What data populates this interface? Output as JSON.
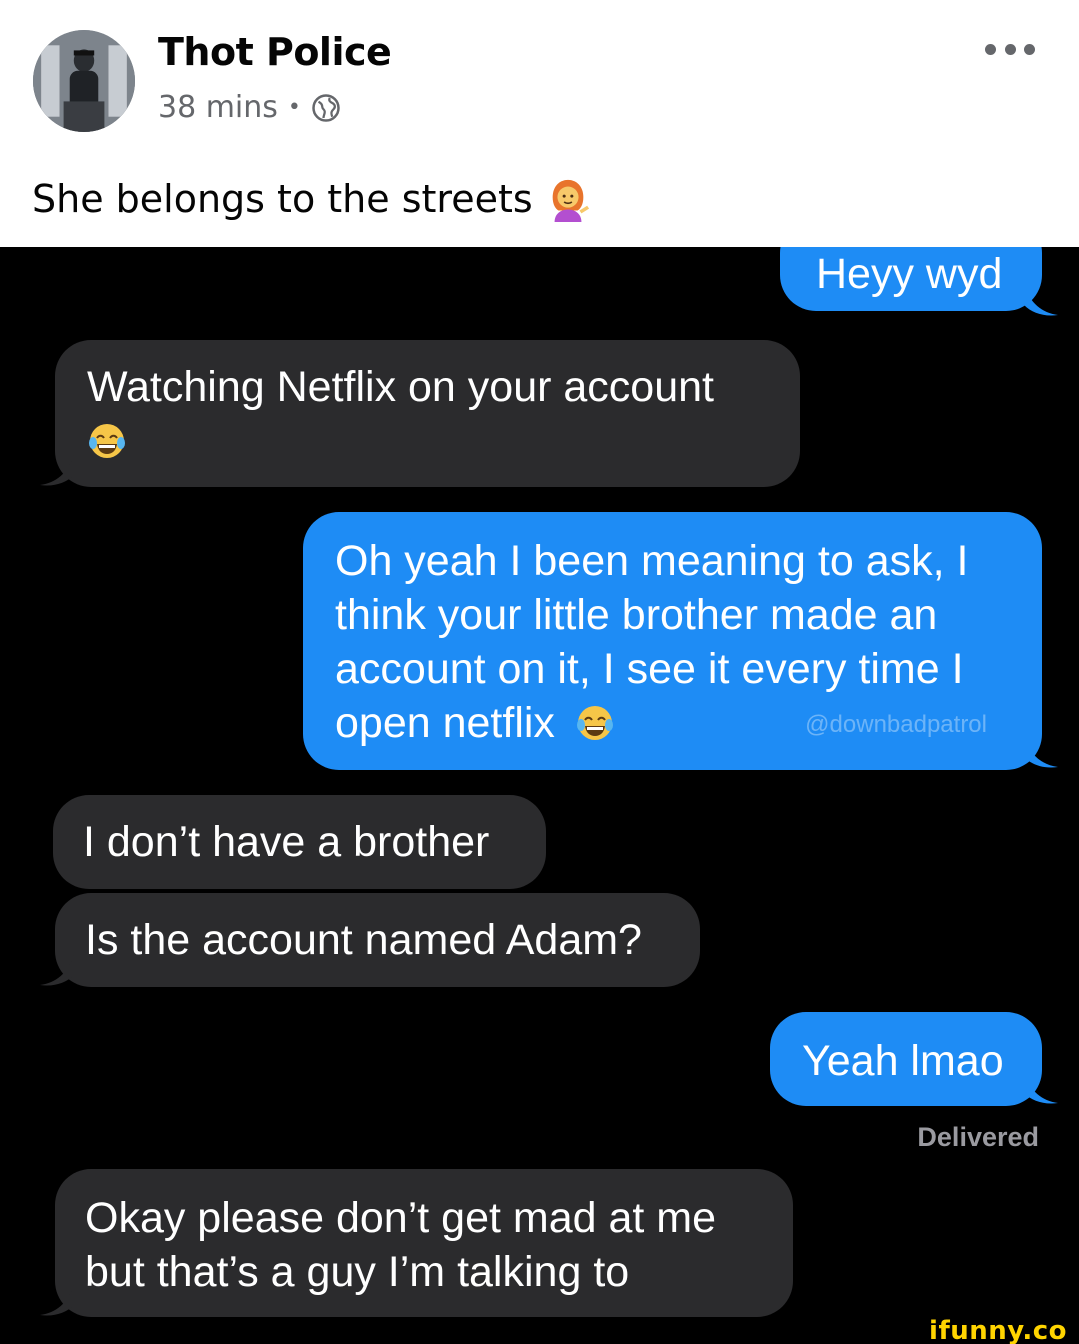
{
  "post": {
    "author": "Thot Police",
    "time": "38 mins",
    "separator": "•",
    "privacy_icon": "globe-icon",
    "more_icon": "more-options-icon",
    "caption": "She belongs to the streets",
    "caption_emoji": "person-tipping-hand-emoji"
  },
  "chat": {
    "messages": [
      {
        "from": "me",
        "text": "Heyy wyd"
      },
      {
        "from": "them",
        "text": "Watching Netflix on your account",
        "emoji": "face-with-tears-of-joy"
      },
      {
        "from": "me",
        "text": "Oh yeah I been meaning to ask, I think your little brother made an account on it, I see it every time I open netflix",
        "emoji": "face-with-tears-of-joy"
      },
      {
        "from": "them",
        "text": "I don’t have a brother"
      },
      {
        "from": "them",
        "text": "Is the account named Adam?"
      },
      {
        "from": "me",
        "text": "Yeah lmao"
      },
      {
        "from": "them",
        "text": "Okay please don’t get mad at me but that’s a guy I’m talking to"
      }
    ],
    "status": "Delivered",
    "watermark_handle": "@downbadpatrol",
    "colors": {
      "incoming": "#2b2b2d",
      "outgoing": "#1e8cf5",
      "background": "#000000"
    }
  },
  "branding": {
    "ifunny": "ifunny.co"
  }
}
